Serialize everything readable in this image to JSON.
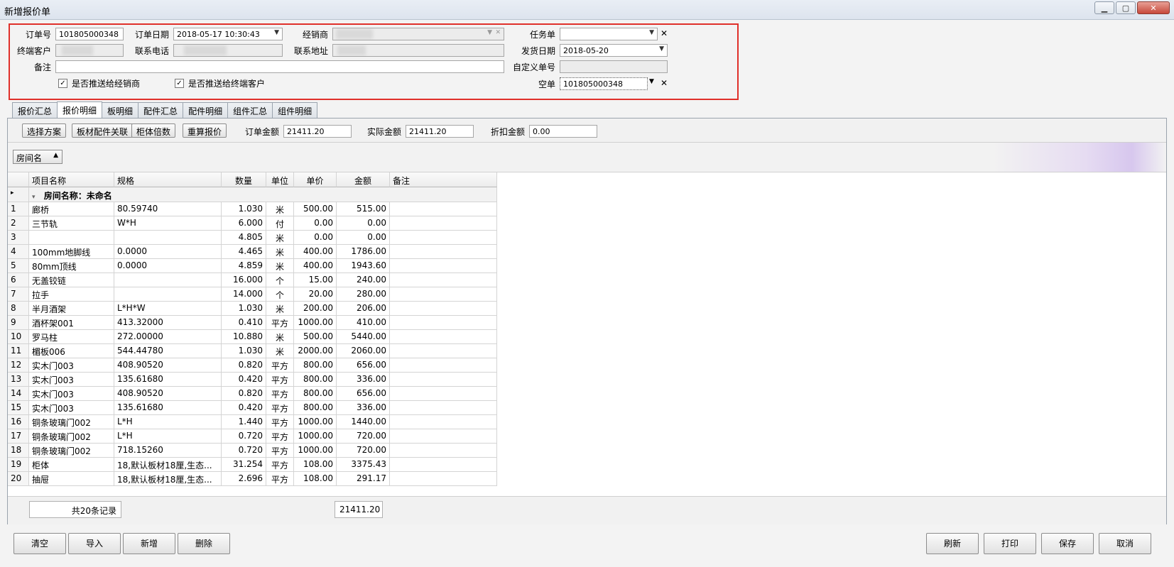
{
  "window": {
    "title": "新增报价单",
    "min": "▁",
    "max": "▢",
    "close": "✕"
  },
  "form": {
    "order_no_label": "订单号",
    "order_no": "101805000348",
    "order_date_label": "订单日期",
    "order_date": "2018-05-17  10:30:43",
    "dealer_label": "经销商",
    "task_label": "任务单",
    "task_value": "",
    "customer_label": "终端客户",
    "phone_label": "联系电话",
    "address_label": "联系地址",
    "ship_date_label": "发货日期",
    "ship_date": "2018-05-20",
    "remark_label": "备注",
    "remark_value": "",
    "custom_no_label": "自定义单号",
    "custom_no": "",
    "push_dealer_label": "是否推送给经销商",
    "push_customer_label": "是否推送给终端客户",
    "empty_label": "空单",
    "empty_value": "101805000348",
    "check_mark": "✓",
    "dropdown": "▼",
    "clear": "✕"
  },
  "tabs": [
    "报价汇总",
    "报价明细",
    "板明细",
    "配件汇总",
    "配件明细",
    "组件汇总",
    "组件明细"
  ],
  "toolbar": {
    "select_scheme": "选择方案",
    "link_parts": "板材配件关联",
    "cabinet_multiple": "柜体倍数",
    "recalc": "重算报价",
    "order_amount_label": "订单金额",
    "order_amount": "21411.20",
    "actual_amount_label": "实际金额",
    "actual_amount": "21411.20",
    "discount_label": "折扣金额",
    "discount_amount": "0.00"
  },
  "group_chip": {
    "label": "房间名",
    "sort": "▲"
  },
  "grid": {
    "headers": [
      "项目名称",
      "规格",
      "数量",
      "单位",
      "单价",
      "金额",
      "备注"
    ],
    "group_row": "房间名称：未命名",
    "group_marker": "▸",
    "group_toggle": "▾",
    "rows": [
      {
        "n": "1",
        "name": "廊桥",
        "spec": "80.59740",
        "qty": "1.030",
        "unit": "米",
        "price": "500.00",
        "amount": "515.00"
      },
      {
        "n": "2",
        "name": "三节轨",
        "spec": "W*H",
        "qty": "6.000",
        "unit": "付",
        "price": "0.00",
        "amount": "0.00"
      },
      {
        "n": "3",
        "name": "",
        "spec": "",
        "qty": "4.805",
        "unit": "米",
        "price": "0.00",
        "amount": "0.00"
      },
      {
        "n": "4",
        "name": "100mm地脚线",
        "spec": "0.0000",
        "qty": "4.465",
        "unit": "米",
        "price": "400.00",
        "amount": "1786.00"
      },
      {
        "n": "5",
        "name": "80mm顶线",
        "spec": "0.0000",
        "qty": "4.859",
        "unit": "米",
        "price": "400.00",
        "amount": "1943.60"
      },
      {
        "n": "6",
        "name": "无盖铰链",
        "spec": "",
        "qty": "16.000",
        "unit": "个",
        "price": "15.00",
        "amount": "240.00"
      },
      {
        "n": "7",
        "name": "拉手",
        "spec": "",
        "qty": "14.000",
        "unit": "个",
        "price": "20.00",
        "amount": "280.00"
      },
      {
        "n": "8",
        "name": "半月酒架",
        "spec": "L*H*W",
        "qty": "1.030",
        "unit": "米",
        "price": "200.00",
        "amount": "206.00"
      },
      {
        "n": "9",
        "name": "酒杯架001",
        "spec": "413.32000",
        "qty": "0.410",
        "unit": "平方",
        "price": "1000.00",
        "amount": "410.00"
      },
      {
        "n": "10",
        "name": "罗马柱",
        "spec": "272.00000",
        "qty": "10.880",
        "unit": "米",
        "price": "500.00",
        "amount": "5440.00"
      },
      {
        "n": "11",
        "name": "楣板006",
        "spec": "544.44780",
        "qty": "1.030",
        "unit": "米",
        "price": "2000.00",
        "amount": "2060.00"
      },
      {
        "n": "12",
        "name": "实木门003",
        "spec": "408.90520",
        "qty": "0.820",
        "unit": "平方",
        "price": "800.00",
        "amount": "656.00"
      },
      {
        "n": "13",
        "name": "实木门003",
        "spec": "135.61680",
        "qty": "0.420",
        "unit": "平方",
        "price": "800.00",
        "amount": "336.00"
      },
      {
        "n": "14",
        "name": "实木门003",
        "spec": "408.90520",
        "qty": "0.820",
        "unit": "平方",
        "price": "800.00",
        "amount": "656.00"
      },
      {
        "n": "15",
        "name": "实木门003",
        "spec": "135.61680",
        "qty": "0.420",
        "unit": "平方",
        "price": "800.00",
        "amount": "336.00"
      },
      {
        "n": "16",
        "name": "铜条玻璃门002",
        "spec": "L*H",
        "qty": "1.440",
        "unit": "平方",
        "price": "1000.00",
        "amount": "1440.00"
      },
      {
        "n": "17",
        "name": "铜条玻璃门002",
        "spec": "L*H",
        "qty": "0.720",
        "unit": "平方",
        "price": "1000.00",
        "amount": "720.00"
      },
      {
        "n": "18",
        "name": "铜条玻璃门002",
        "spec": "718.15260",
        "qty": "0.720",
        "unit": "平方",
        "price": "1000.00",
        "amount": "720.00"
      },
      {
        "n": "19",
        "name": "柜体",
        "spec": "18,默认板材18厘,生态...",
        "qty": "31.254",
        "unit": "平方",
        "price": "108.00",
        "amount": "3375.43"
      },
      {
        "n": "20",
        "name": "抽屉",
        "spec": "18,默认板材18厘,生态...",
        "qty": "2.696",
        "unit": "平方",
        "price": "108.00",
        "amount": "291.17"
      }
    ],
    "record_count": "共20条记录",
    "total_amount": "21411.20"
  },
  "buttons": {
    "clear": "清空",
    "import": "导入",
    "add": "新增",
    "delete": "删除",
    "refresh": "刷新",
    "print": "打印",
    "save": "保存",
    "cancel": "取消"
  }
}
